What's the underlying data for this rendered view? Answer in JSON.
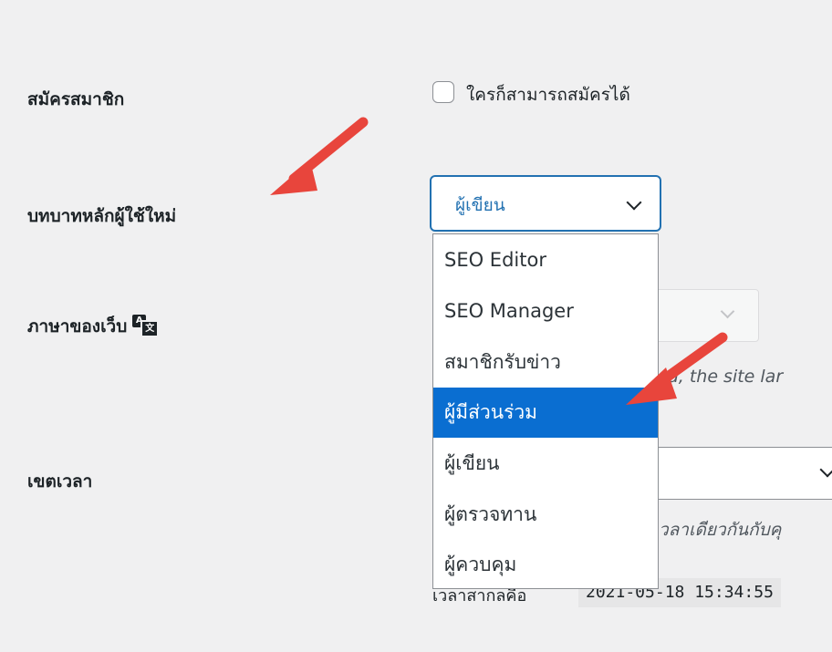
{
  "rows": {
    "membership_label": "สมัครสมาชิก",
    "new_user_role_label": "บทบาทหลักผู้ใช้ใหม่",
    "site_language_label": "ภาษาของเว็บ",
    "timezone_label": "เขตเวลา"
  },
  "membership": {
    "checkbox_label": "ใครก็สามารถสมัครได้",
    "checked": false
  },
  "new_user_role": {
    "selected": "ผู้เขียน",
    "options": [
      {
        "label": "SEO Editor",
        "highlighted": false
      },
      {
        "label": "SEO Manager",
        "highlighted": false
      },
      {
        "label": "สมาชิกรับข่าว",
        "highlighted": false
      },
      {
        "label": "ผู้มีส่วนร่วม",
        "highlighted": true
      },
      {
        "label": "ผู้เขียน",
        "highlighted": false
      },
      {
        "label": "ผู้ตรวจทาน",
        "highlighted": false
      },
      {
        "label": "ผู้ควบคุม",
        "highlighted": false
      }
    ]
  },
  "site_language": {
    "description_fragment": "ed, the site lar"
  },
  "timezone": {
    "description_fragment": "วลาเดียวกันกับคุ",
    "utc_label": "เวลาสากลคือ",
    "utc_time": "2021-05-18 15:34:55"
  },
  "icons": {
    "translate": "translate-icon",
    "chevron": "chevron-down-icon",
    "arrow": "red-pointer-arrow"
  },
  "colors": {
    "accent": "#2271b1",
    "highlight": "#0a6ed1",
    "arrow": "#e8453c",
    "background": "#f0f0f1"
  }
}
